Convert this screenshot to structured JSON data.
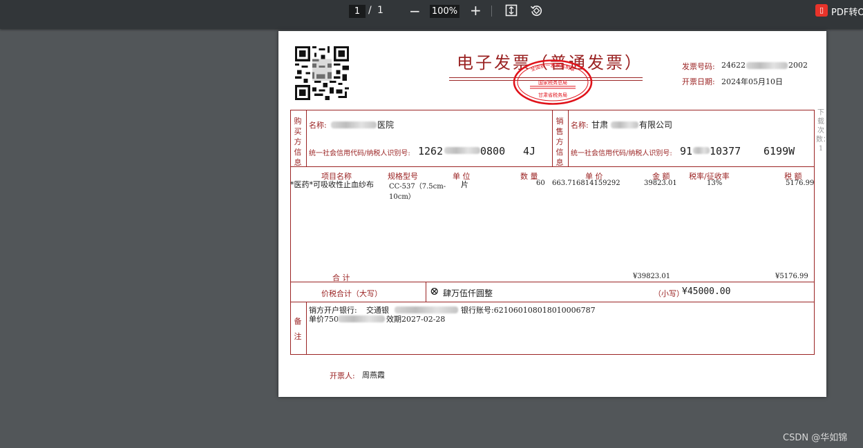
{
  "toolbar": {
    "page_current": "1",
    "page_separator": "/",
    "page_total": "1",
    "zoom_minus": "−",
    "zoom_level": "100%",
    "zoom_plus": "+",
    "pdf_tool_logo": "▯",
    "pdf_tool_label": "PDF转O"
  },
  "invoice": {
    "title": "电子发票（普通发票）",
    "invoice_number_label": "发票号码:",
    "invoice_number_value": "24622",
    "invoice_number_tail": "2002",
    "issue_date_label": "开票日期:",
    "issue_date_value": "2024年05月10日",
    "buyer_section_label": "购买方信息",
    "buyer_name_label": "名称:",
    "buyer_name_value": "医院",
    "buyer_tax_label": "统一社会信用代码/纳税人识别号:",
    "buyer_tax_value": "1262",
    "buyer_tax_mid": "0800",
    "buyer_tax_tail": "4J",
    "seller_section_label": "销售方信息",
    "seller_name_label": "名称:",
    "seller_name_prefix": "甘肃",
    "seller_name_suffix": "有限公司",
    "seller_tax_label": "统一社会信用代码/纳税人识别号:",
    "seller_tax_value": "91",
    "seller_tax_mid": "10377",
    "seller_tax_tail": "6199W",
    "side_note": "下载次数：1",
    "columns": {
      "item_name": "项目名称",
      "spec": "规格型号",
      "unit": "单  位",
      "quantity": "数  量",
      "unit_price": "单  价",
      "amount": "金  额",
      "tax_rate": "税率/征收率",
      "tax": "税  额"
    },
    "items": [
      {
        "name": "*医药*可吸收性止血纱布",
        "spec_line1": "CC-537（7.5cm-",
        "spec_line2": "10cm）",
        "unit": "片",
        "quantity": "60",
        "unit_price": "663.716814159292",
        "amount": "39823.01",
        "tax_rate": "13%",
        "tax": "5176.99"
      }
    ],
    "total_label": "合        计",
    "total_amount": "¥39823.01",
    "total_tax": "¥5176.99",
    "grand_total_label": "价税合计（大写）",
    "grand_total_words_icon": "⊗",
    "grand_total_words": "肆万伍仟圆整",
    "grand_total_small_label": "（小写）",
    "grand_total_value": "¥45000.00",
    "remarks_label": "备注",
    "remarks_line1_prefix": "销方开户银行:",
    "remarks_line1_mid": "交通银",
    "remarks_line1_suffix": "银行账号:621060108018010006787",
    "remarks_line2_prefix": "单价750",
    "remarks_line2_suffix": "效期2027-02-28",
    "issuer_label": "开票人:",
    "issuer_value": "周燕霞",
    "seal_top_text": "全国统一发票监制章",
    "seal_mid_text": "国家税务总局",
    "seal_bottom_text": "甘肃省税务局"
  },
  "watermark": "CSDN @华如锦",
  "colors": {
    "invoice_red": "#9a2222",
    "seal_red": "#e0121a",
    "toolbar_bg": "#323639",
    "viewer_bg": "#525659"
  }
}
